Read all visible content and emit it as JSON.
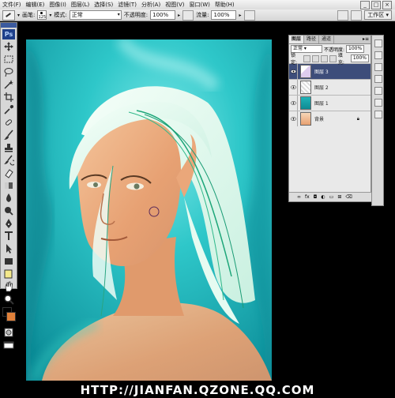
{
  "menu": [
    "文件(F)",
    "编辑(E)",
    "图像(I)",
    "图层(L)",
    "选择(S)",
    "滤镜(T)",
    "分析(A)",
    "视图(V)",
    "窗口(W)",
    "帮助(H)"
  ],
  "window_controls": [
    "_",
    "□",
    "×"
  ],
  "options": {
    "brush_label": "画笔:",
    "brush_size": "125",
    "mode_label": "模式:",
    "mode_value": "正常",
    "opacity_label": "不透明度:",
    "opacity_value": "100%",
    "flow_label": "流量:",
    "flow_value": "100%",
    "workspace_label": "工作区"
  },
  "toolbox": {
    "logo": "Ps",
    "tools": [
      "move-tool-icon",
      "marquee-tool-icon",
      "lasso-tool-icon",
      "magic-wand-tool-icon",
      "crop-tool-icon",
      "eyedropper-tool-icon",
      "healing-brush-tool-icon",
      "brush-tool-icon",
      "clone-stamp-tool-icon",
      "history-brush-tool-icon",
      "eraser-tool-icon",
      "gradient-tool-icon",
      "blur-tool-icon",
      "dodge-tool-icon",
      "pen-tool-icon",
      "type-tool-icon",
      "path-selection-tool-icon",
      "shape-tool-icon",
      "notes-tool-icon",
      "hand-tool-icon",
      "zoom-tool-icon"
    ],
    "foreground_color": "#000000",
    "background_color": "#e0803a"
  },
  "layers_panel": {
    "tabs": [
      "图层",
      "路径",
      "通道"
    ],
    "blend_mode": "正常",
    "opacity_label": "不透明度:",
    "opacity_value": "100%",
    "lock_label": "锁定:",
    "fill_label": "填充:",
    "fill_value": "100%",
    "layers": [
      {
        "name": "图层 3",
        "selected": true
      },
      {
        "name": "图层 2",
        "selected": false
      },
      {
        "name": "图层 1",
        "selected": false
      },
      {
        "name": "背景",
        "selected": false,
        "locked": true
      }
    ],
    "footer_icons": [
      "link-icon",
      "fx-icon",
      "mask-icon",
      "adjustment-icon",
      "folder-icon",
      "new-layer-icon",
      "trash-icon"
    ]
  },
  "watermark": "HTTP://JIANFAN.QZONE.QQ.COM"
}
